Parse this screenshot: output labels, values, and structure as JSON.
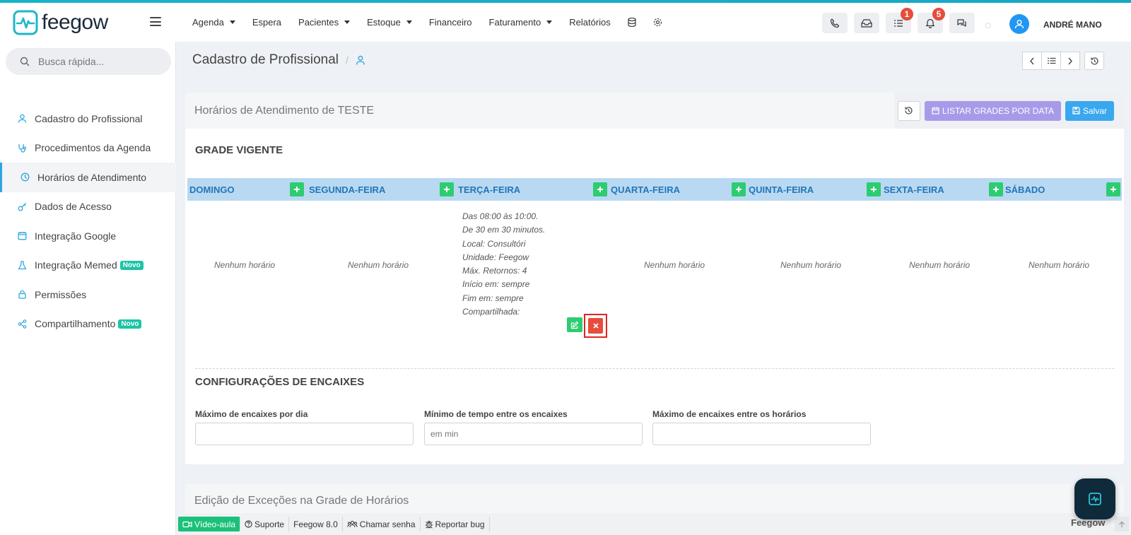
{
  "header": {
    "brand": "feegow",
    "nav": [
      {
        "label": "Agenda",
        "dropdown": true
      },
      {
        "label": "Espera",
        "dropdown": false
      },
      {
        "label": "Pacientes",
        "dropdown": true
      },
      {
        "label": "Estoque",
        "dropdown": true
      },
      {
        "label": "Financeiro",
        "dropdown": false
      },
      {
        "label": "Faturamento",
        "dropdown": true
      },
      {
        "label": "Relatórios",
        "dropdown": false
      }
    ],
    "tasks_badge": "1",
    "notifications_badge": "5",
    "user_name": "ANDRÉ MANO"
  },
  "sidebar": {
    "search_placeholder": "Busca rápida...",
    "items": [
      {
        "label": "Cadastro do Profissional",
        "icon": "user-icon",
        "active": false
      },
      {
        "label": "Procedimentos da Agenda",
        "icon": "stethoscope-icon",
        "active": false
      },
      {
        "label": "Horários de Atendimento",
        "icon": "clock-icon",
        "active": true
      },
      {
        "label": "Dados de Acesso",
        "icon": "key-icon",
        "active": false
      },
      {
        "label": "Integração Google",
        "icon": "calendar-icon",
        "active": false
      },
      {
        "label": "Integração Memed",
        "icon": "flask-icon",
        "active": false,
        "badge": "Novo"
      },
      {
        "label": "Permissões",
        "icon": "lock-icon",
        "active": false
      },
      {
        "label": "Compartilhamento",
        "icon": "share-icon",
        "active": false,
        "badge": "Novo"
      }
    ]
  },
  "breadcrumb": {
    "title": "Cadastro de Profissional",
    "separator": "/"
  },
  "card": {
    "title": "Horários de Atendimento de TESTE",
    "listar_label": "LISTAR GRADES POR DATA",
    "salvar_label": "Salvar"
  },
  "grade": {
    "title": "GRADE VIGENTE",
    "days": [
      "DOMINGO",
      "SEGUNDA-FEIRA",
      "TERÇA-FEIRA",
      "QUARTA-FEIRA",
      "QUINTA-FEIRA",
      "SEXTA-FEIRA",
      "SÁBADO"
    ],
    "empty_label": "Nenhum horário",
    "slot_lines": [
      "Das 08:00 às 10:00.",
      "De 30 em 30 minutos.",
      "Local: Consultóri",
      "Unidade: Feegow",
      "Máx. Retornos: 4",
      "Início em: sempre",
      "Fim em: sempre",
      "Compartilhada:"
    ]
  },
  "encaixes": {
    "title": "CONFIGURAÇÕES DE ENCAIXES",
    "max_por_dia_label": "Máximo de encaixes por dia",
    "min_tempo_label": "Mínimo de tempo entre os encaixes",
    "min_tempo_placeholder": "em min",
    "max_entre_label": "Máximo de encaixes entre os horários"
  },
  "excecoes": {
    "title": "Edição de Exceções na Grade de Horários"
  },
  "footer": {
    "video": "Vídeo-aula",
    "suporte": "Suporte",
    "version": "Feegow 8.0",
    "chamar": "Chamar senha",
    "bug": "Reportar bug",
    "brand": "Feegow"
  },
  "colors": {
    "accent": "#2ea7e0",
    "day_header_bg": "#b9d9f2",
    "add_green": "#2ecc71",
    "delete_red": "#e74c3c",
    "listar_purple": "#a79be9",
    "salvar_blue": "#3ba7ef"
  }
}
